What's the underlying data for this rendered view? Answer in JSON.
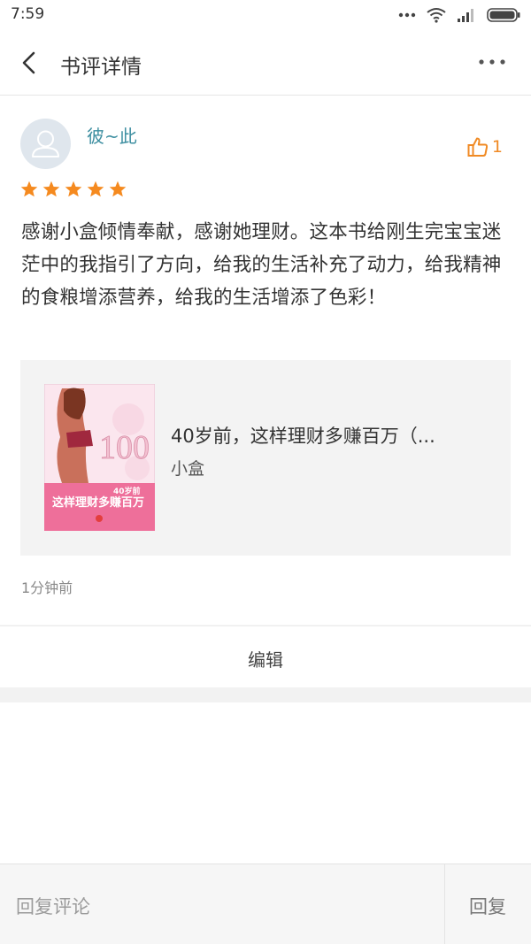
{
  "status_bar": {
    "time": "7:59",
    "icons": [
      "more-dots-icon",
      "wifi-icon",
      "signal-icon",
      "battery-icon"
    ]
  },
  "header": {
    "back_icon": "chevron-left-icon",
    "title": "书评详情",
    "more_icon": "more-horizontal-icon"
  },
  "review": {
    "username": "彼~此",
    "avatar_icon": "user-silhouette-icon",
    "like_count": "1",
    "rating": 5,
    "text": "感谢小盒倾情奉献，感谢她理财。这本书给刚生完宝宝迷茫中的我指引了方向，给我的生活补充了动力，给我精神的食粮增添营养，给我的生活增添了色彩！",
    "time_ago": "1分钟前"
  },
  "book": {
    "title": "40岁前，这样理财多赚百万（...",
    "author": "小盒",
    "cover_lettering": {
      "big_number": "100",
      "badge": "40岁前",
      "banner": "这样理财多赚百万"
    }
  },
  "actions": {
    "edit_label": "编辑"
  },
  "reply_bar": {
    "placeholder": "回复评论",
    "reply_label": "回复"
  },
  "colors": {
    "accent_teal": "#3e8fa1",
    "star_orange": "#f58a1f",
    "like_orange": "#f08a24"
  }
}
